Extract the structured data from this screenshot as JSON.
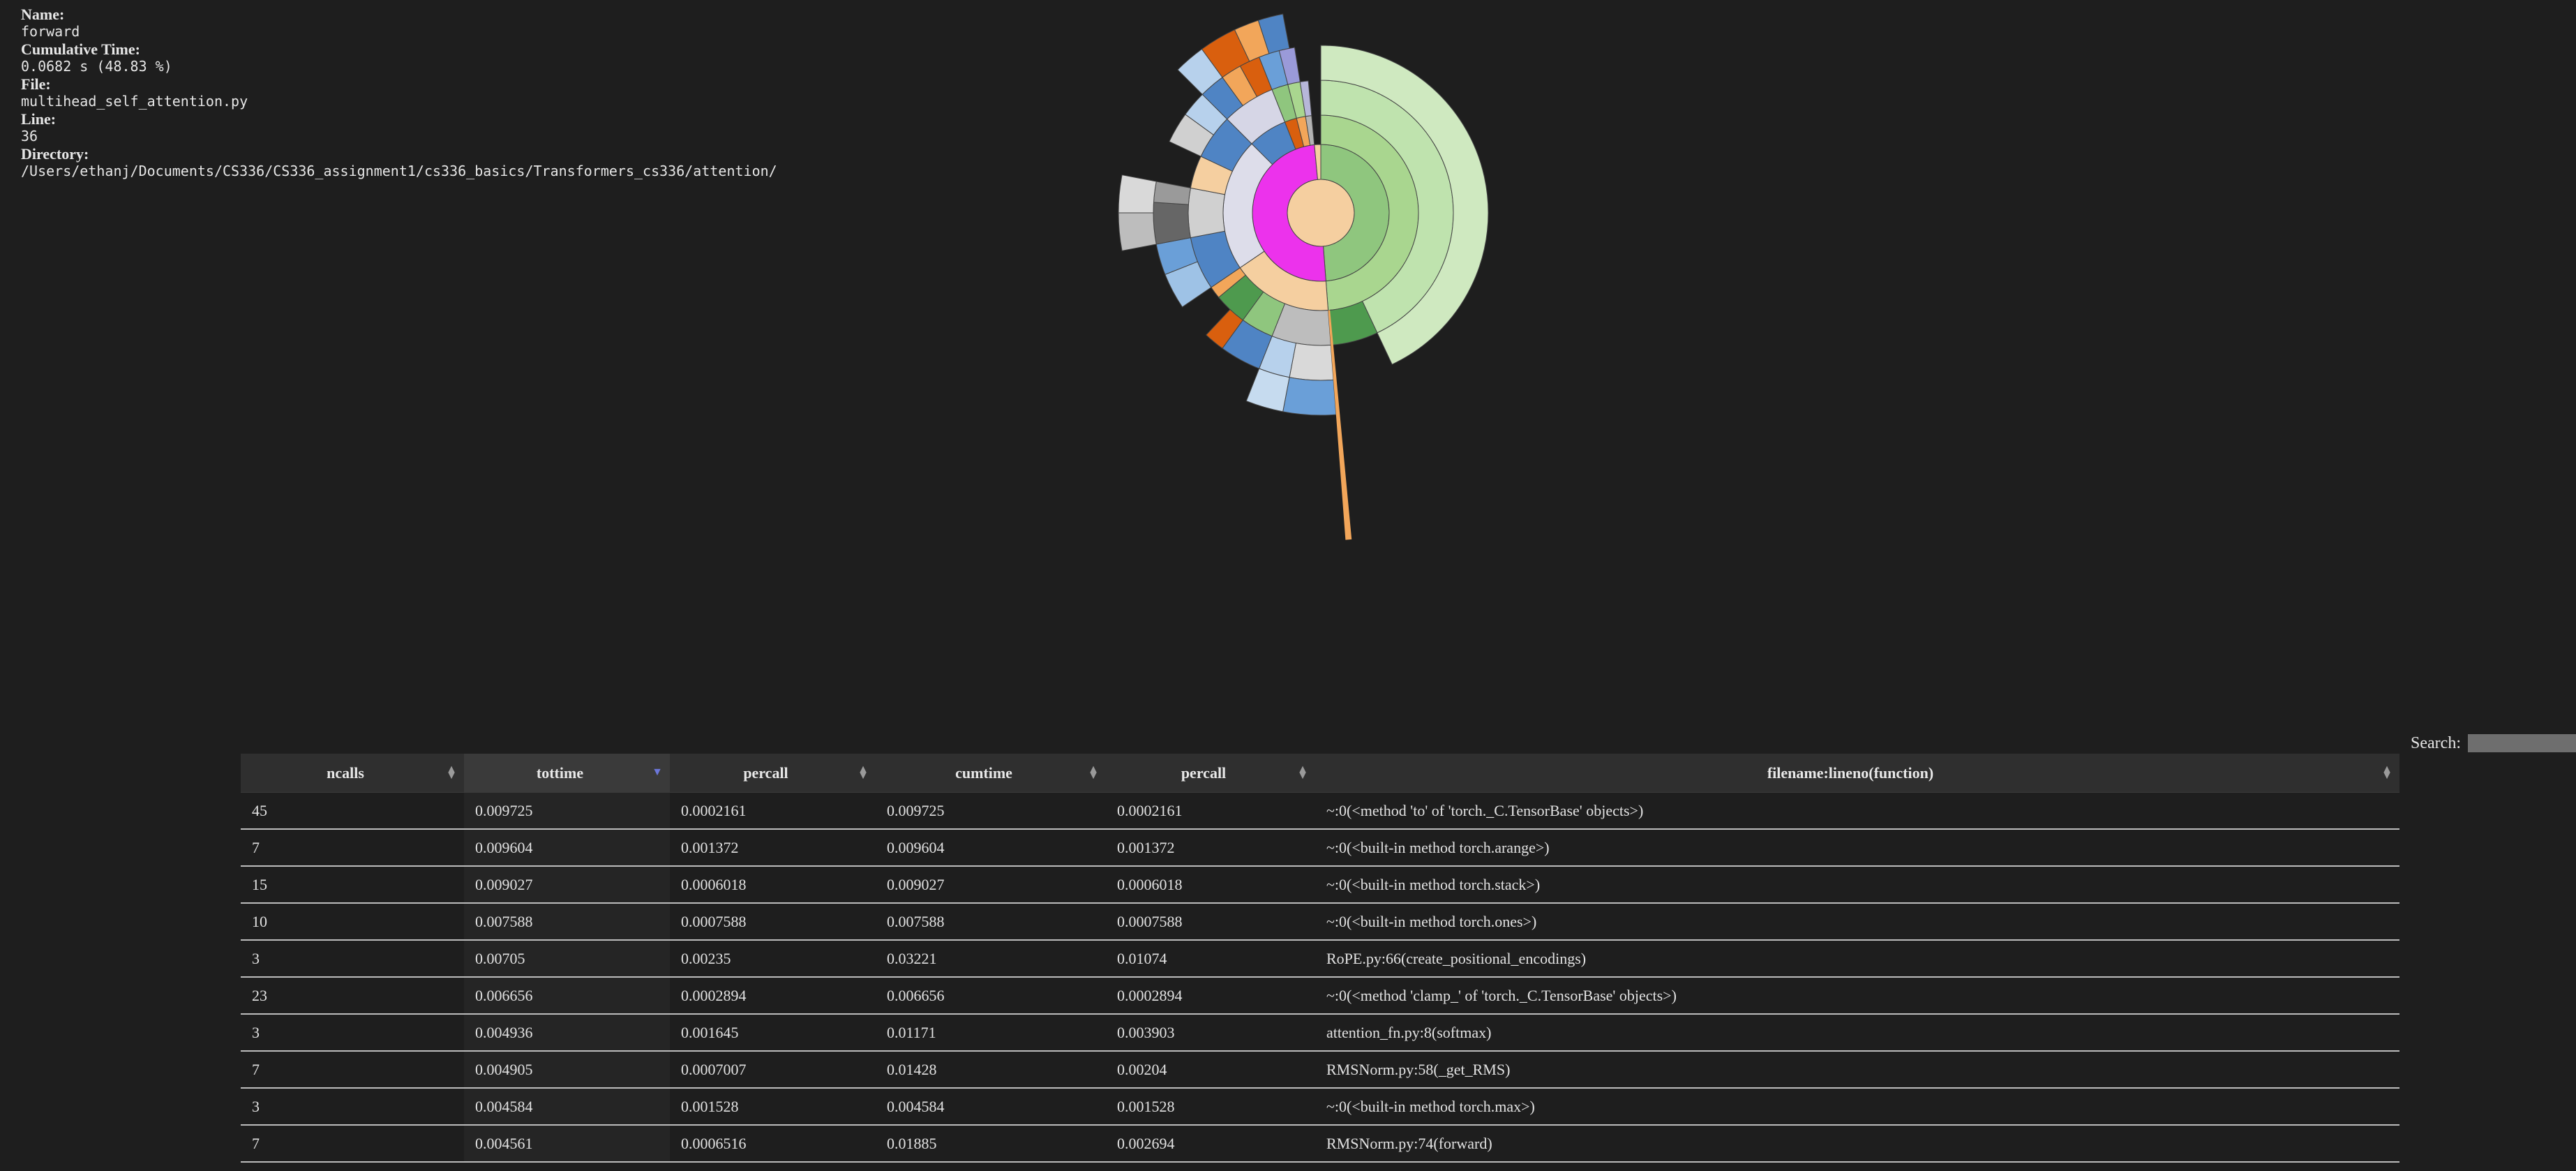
{
  "info": {
    "name_label": "Name:",
    "name_value": "forward",
    "cumtime_label": "Cumulative Time:",
    "cumtime_value": "0.0682 s (48.83 %)",
    "file_label": "File:",
    "file_value": "multihead_self_attention.py",
    "line_label": "Line:",
    "line_value": "36",
    "dir_label": "Directory:",
    "dir_value": "/Users/ethanj/Documents/CS336/CS336_assignment1/cs336_basics/Transformers_cs336/attention/"
  },
  "search": {
    "label": "Search:",
    "value": ""
  },
  "table": {
    "columns": [
      "ncalls",
      "tottime",
      "percall",
      "cumtime",
      "percall",
      "filename:lineno(function)"
    ],
    "sorted_column": "tottime",
    "rows": [
      [
        "45",
        "0.009725",
        "0.0002161",
        "0.009725",
        "0.0002161",
        "~:0(<method 'to' of 'torch._C.TensorBase' objects>)"
      ],
      [
        "7",
        "0.009604",
        "0.001372",
        "0.009604",
        "0.001372",
        "~:0(<built-in method torch.arange>)"
      ],
      [
        "15",
        "0.009027",
        "0.0006018",
        "0.009027",
        "0.0006018",
        "~:0(<built-in method torch.stack>)"
      ],
      [
        "10",
        "0.007588",
        "0.0007588",
        "0.007588",
        "0.0007588",
        "~:0(<built-in method torch.ones>)"
      ],
      [
        "3",
        "0.00705",
        "0.00235",
        "0.03221",
        "0.01074",
        "RoPE.py:66(create_positional_encodings)"
      ],
      [
        "23",
        "0.006656",
        "0.0002894",
        "0.006656",
        "0.0002894",
        "~:0(<method 'clamp_' of 'torch._C.TensorBase' objects>)"
      ],
      [
        "3",
        "0.004936",
        "0.001645",
        "0.01171",
        "0.003903",
        "attention_fn.py:8(softmax)"
      ],
      [
        "7",
        "0.004905",
        "0.0007007",
        "0.01428",
        "0.00204",
        "RMSNorm.py:58(_get_RMS)"
      ],
      [
        "3",
        "0.004584",
        "0.001528",
        "0.004584",
        "0.001528",
        "~:0(<built-in method torch.max>)"
      ],
      [
        "7",
        "0.004561",
        "0.0006516",
        "0.01885",
        "0.002694",
        "RMSNorm.py:74(forward)"
      ]
    ]
  },
  "sunburst": {
    "rings": [
      {
        "level": 1,
        "segments": [
          {
            "start": 0.0,
            "end": 0.488,
            "color": "#8fc67e"
          },
          {
            "start": 0.488,
            "end": 0.985,
            "color": "#ec32ec"
          },
          {
            "start": 0.985,
            "end": 1.0,
            "color": "#f5cfa0"
          }
        ]
      },
      {
        "level": 2,
        "segments": [
          {
            "start": 0.0,
            "end": 0.488,
            "color": "#a9d68f"
          },
          {
            "start": 0.488,
            "end": 0.655,
            "color": "#f5cfa0"
          },
          {
            "start": 0.655,
            "end": 0.875,
            "color": "#ddddea"
          },
          {
            "start": 0.875,
            "end": 0.94,
            "color": "#4f84c4"
          },
          {
            "start": 0.94,
            "end": 0.96,
            "color": "#d95f0e"
          },
          {
            "start": 0.96,
            "end": 0.975,
            "color": "#f2a65a"
          },
          {
            "start": 0.975,
            "end": 0.985,
            "color": "#b3b3b3"
          }
        ]
      },
      {
        "level": 3,
        "segments": [
          {
            "start": 0.0,
            "end": 0.43,
            "color": "#bfe3ae"
          },
          {
            "start": 0.43,
            "end": 0.488,
            "color": "#4e9a4e"
          },
          {
            "start": 0.488,
            "end": 0.56,
            "color": "#bdbdbd"
          },
          {
            "start": 0.56,
            "end": 0.6,
            "color": "#8fc67e"
          },
          {
            "start": 0.6,
            "end": 0.64,
            "color": "#4e9a4e"
          },
          {
            "start": 0.64,
            "end": 0.655,
            "color": "#f2a65a"
          },
          {
            "start": 0.655,
            "end": 0.72,
            "color": "#4f84c4"
          },
          {
            "start": 0.72,
            "end": 0.78,
            "color": "#d0d0d0"
          },
          {
            "start": 0.78,
            "end": 0.82,
            "color": "#f5cfa0"
          },
          {
            "start": 0.82,
            "end": 0.875,
            "color": "#4f84c4"
          },
          {
            "start": 0.875,
            "end": 0.94,
            "color": "#d6d6e6"
          },
          {
            "start": 0.94,
            "end": 0.96,
            "color": "#8fc67e"
          },
          {
            "start": 0.96,
            "end": 0.975,
            "color": "#a9d68f"
          },
          {
            "start": 0.975,
            "end": 0.985,
            "color": "#b7b7d9"
          }
        ]
      },
      {
        "level": 4,
        "segments": [
          {
            "start": 0.0,
            "end": 0.43,
            "color": "#cfe9c0"
          },
          {
            "start": 0.488,
            "end": 0.53,
            "color": "#d9d9d9"
          },
          {
            "start": 0.53,
            "end": 0.56,
            "color": "#b7d1ec"
          },
          {
            "start": 0.56,
            "end": 0.6,
            "color": "#4f84c4"
          },
          {
            "start": 0.6,
            "end": 0.62,
            "color": "#d95f0e"
          },
          {
            "start": 0.655,
            "end": 0.69,
            "color": "#9ec2e6"
          },
          {
            "start": 0.69,
            "end": 0.72,
            "color": "#6a9fd8"
          },
          {
            "start": 0.72,
            "end": 0.76,
            "color": "#666666"
          },
          {
            "start": 0.76,
            "end": 0.78,
            "color": "#9a9a9a"
          },
          {
            "start": 0.82,
            "end": 0.85,
            "color": "#d0d0d0"
          },
          {
            "start": 0.85,
            "end": 0.875,
            "color": "#b7d1ec"
          },
          {
            "start": 0.875,
            "end": 0.9,
            "color": "#4f84c4"
          },
          {
            "start": 0.9,
            "end": 0.92,
            "color": "#f2a65a"
          },
          {
            "start": 0.92,
            "end": 0.94,
            "color": "#d95f0e"
          },
          {
            "start": 0.94,
            "end": 0.96,
            "color": "#6a9fd8"
          },
          {
            "start": 0.96,
            "end": 0.975,
            "color": "#9a9ad9"
          }
        ]
      },
      {
        "level": 5,
        "segments": [
          {
            "start": 0.488,
            "end": 0.53,
            "color": "#6a9fd8"
          },
          {
            "start": 0.53,
            "end": 0.56,
            "color": "#c6dbef"
          },
          {
            "start": 0.72,
            "end": 0.75,
            "color": "#bdbdbd"
          },
          {
            "start": 0.75,
            "end": 0.78,
            "color": "#d9d9d9"
          },
          {
            "start": 0.875,
            "end": 0.9,
            "color": "#b7d1ec"
          },
          {
            "start": 0.9,
            "end": 0.93,
            "color": "#d95f0e"
          },
          {
            "start": 0.93,
            "end": 0.95,
            "color": "#f2a65a"
          },
          {
            "start": 0.95,
            "end": 0.97,
            "color": "#4f84c4"
          }
        ]
      }
    ]
  }
}
